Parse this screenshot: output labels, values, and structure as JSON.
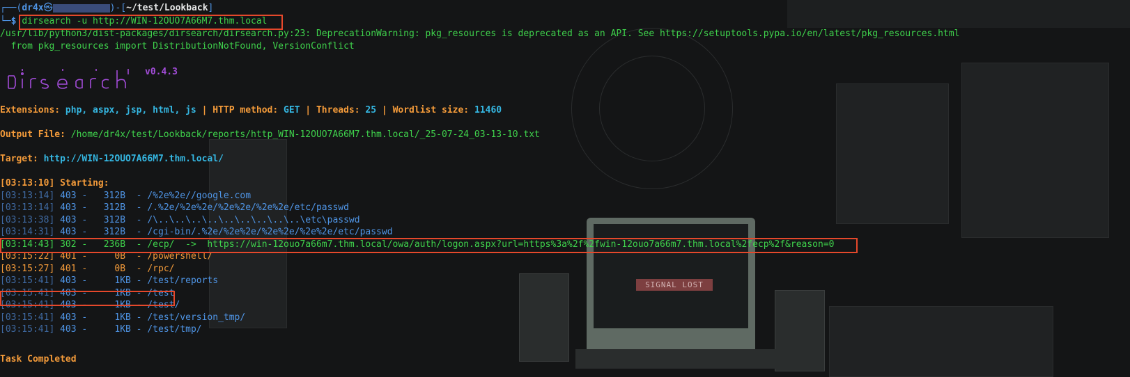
{
  "prompt": {
    "corner_top": "┌──(",
    "user": "dr4x",
    "at": "㉿",
    "host": "",
    "mid": ")-[",
    "path": "~/test/Lookback",
    "end": "]",
    "corner_bottom": "└─",
    "symbol": "$",
    "command": "dirsearch -u http://WIN-12OUO7A66M7.thm.local"
  },
  "warning": {
    "line1": "/usr/lib/python3/dist-packages/dirsearch/dirsearch.py:23: DeprecationWarning: pkg_resources is deprecated as an API. See https://setuptools.pypa.io/en/latest/pkg_resources.html",
    "line2": "  from pkg_resources import DistributionNotFound, VersionConflict"
  },
  "logo": {
    "version": "v0.4.3",
    "color": "#a24cd8"
  },
  "config": {
    "extensions_label": "Extensions: ",
    "extensions_value": "php, aspx, jsp, html, js",
    "sep": " | ",
    "method_label": "HTTP method: ",
    "method_value": "GET",
    "threads_label": "Threads: ",
    "threads_value": "25",
    "wordlist_label": "Wordlist size: ",
    "wordlist_value": "11460"
  },
  "output": {
    "label": "Output File: ",
    "value": "/home/dr4x/test/Lookback/reports/http_WIN-12OUO7A66M7.thm.local/_25-07-24_03-13-10.txt"
  },
  "target": {
    "label": "Target: ",
    "value": "http://WIN-12OUO7A66M7.thm.local/"
  },
  "starting": {
    "time": "[03:13:10]",
    "label": " Starting:"
  },
  "results": [
    {
      "time": "[03:13:14]",
      "rest": " 403 -   312B  - /%2e%2e//google.com",
      "kind": "blue"
    },
    {
      "time": "[03:13:14]",
      "rest": " 403 -   312B  - /.%2e/%2e%2e/%2e%2e/%2e%2e/etc/passwd",
      "kind": "blue"
    },
    {
      "time": "[03:13:38]",
      "rest": " 403 -   312B  - /\\..\\..\\..\\..\\..\\..\\..\\..\\..\\etc\\passwd",
      "kind": "blue"
    },
    {
      "time": "[03:14:31]",
      "rest": " 403 -   312B  - /cgi-bin/.%2e/%2e%2e/%2e%2e/%2e%2e/etc/passwd",
      "kind": "blue"
    },
    {
      "time": "[03:14:43]",
      "rest": " 302 -   236B  - /ecp/  ->  https://win-12ouo7a66m7.thm.local/owa/auth/logon.aspx?url=https%3a%2f%2fwin-12ouo7a66m7.thm.local%2fecp%2f&reason=0",
      "kind": "green"
    },
    {
      "time": "[03:15:22]",
      "rest": " 401 -     0B  - /powershell/",
      "kind": "yellow"
    },
    {
      "time": "[03:15:27]",
      "rest": " 401 -     0B  - /rpc/",
      "kind": "yellow"
    },
    {
      "time": "[03:15:41]",
      "rest": " 403 -     1KB - /test/reports",
      "kind": "blue"
    },
    {
      "time": "[03:15:41]",
      "rest": " 403 -     1KB - /test",
      "kind": "blue"
    },
    {
      "time": "[03:15:41]",
      "rest": " 403 -     1KB - /test/",
      "kind": "blue"
    },
    {
      "time": "[03:15:41]",
      "rest": " 403 -     1KB - /test/version_tmp/",
      "kind": "blue"
    },
    {
      "time": "[03:15:41]",
      "rest": " 403 -     1KB - /test/tmp/",
      "kind": "blue"
    }
  ],
  "done": "Task Completed",
  "background": {
    "signal_text": "SIGNAL LOST"
  },
  "colors": {
    "background": "#141516",
    "blue": "#4f95e6",
    "green": "#3fd24c",
    "orange": "#f49b3a",
    "cyan": "#35b7e2",
    "highlight": "#e5482b"
  }
}
